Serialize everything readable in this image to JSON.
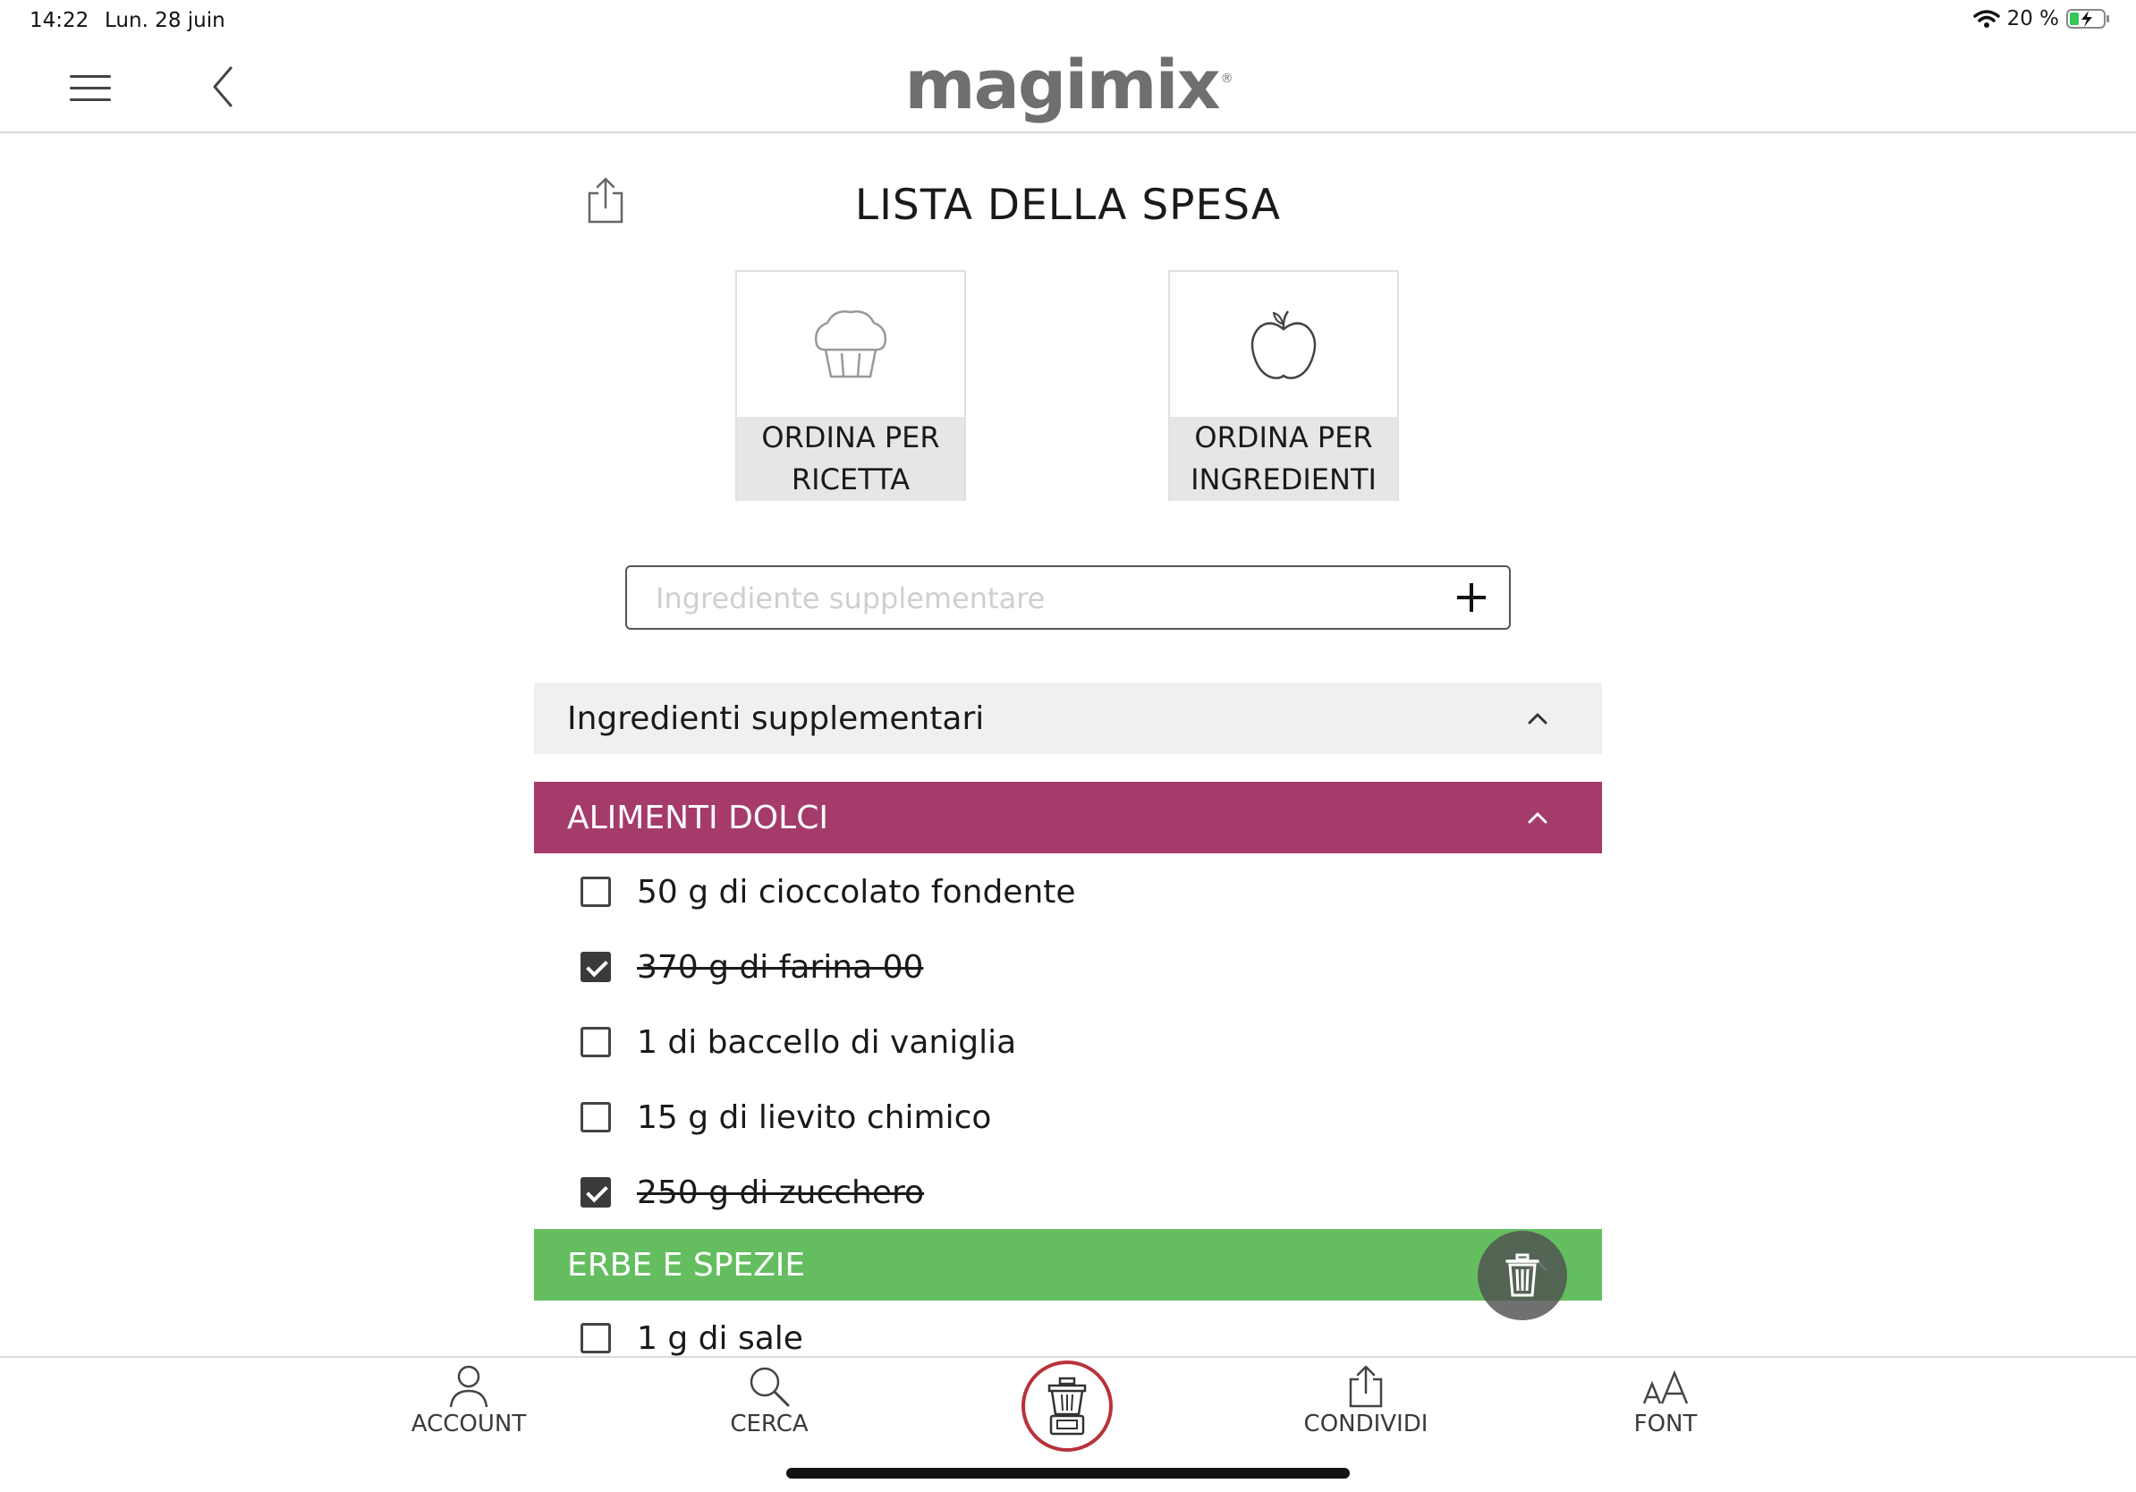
{
  "status_bar": {
    "time": "14:22",
    "date": "Lun. 28 juin",
    "battery": "20 %"
  },
  "header": {
    "logo": "magimix"
  },
  "page": {
    "title": "LISTA DELLA SPESA"
  },
  "order_options": [
    {
      "label_line1": "ORDINA PER",
      "label_line2": "RICETTA",
      "icon": "muffin-icon"
    },
    {
      "label_line1": "ORDINA PER",
      "label_line2": "INGREDIENTI",
      "icon": "apple-icon"
    }
  ],
  "add_field": {
    "placeholder": "Ingrediente supplementare",
    "value": ""
  },
  "sections": {
    "extra": {
      "title": "Ingredienti supplementari",
      "expanded": true
    },
    "sweets": {
      "title": "ALIMENTI DOLCI",
      "color": "#a53b6b",
      "expanded": true,
      "items": [
        {
          "text": "50 g di cioccolato fondente",
          "checked": false
        },
        {
          "text": "370 g di farina 00",
          "checked": true
        },
        {
          "text": "1 di baccello di vaniglia",
          "checked": false
        },
        {
          "text": "15 g di lievito chimico",
          "checked": false
        },
        {
          "text": "250 g di zucchero",
          "checked": true
        }
      ]
    },
    "herbs": {
      "title": "ERBE E SPEZIE",
      "color": "#64be60",
      "expanded": true,
      "items": [
        {
          "text": "1 g di sale",
          "checked": false
        }
      ]
    }
  },
  "tab_bar": {
    "account": "ACCOUNT",
    "search": "CERCA",
    "share": "CONDIVIDI",
    "font": "FONT",
    "accent": "#b8323a"
  }
}
